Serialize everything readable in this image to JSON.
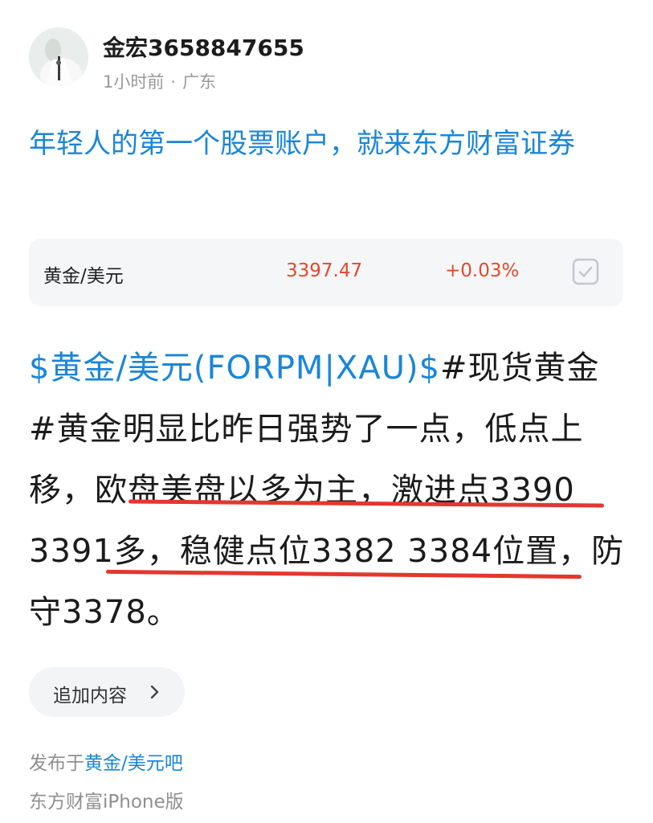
{
  "author": {
    "name": "金宏3658847655",
    "time": "1小时前",
    "separator": "·",
    "location": "广东"
  },
  "headline": {
    "text": "年轻人的第一个股票账户，就来东方财富证券"
  },
  "quote": {
    "name": "黄金/美元",
    "price": "3397.47",
    "change": "+0.03%",
    "price_color": "#e4482e",
    "icon": "checkbox-icon"
  },
  "post": {
    "tag": "$黄金/美元(FORPM|XAU)$",
    "body": "#现货黄金#黄金明显比昨日强势了一点，低点上移，欧盘美盘以多为主，激进点3390 3391多，稳健点位3382 3384位置，防守3378。",
    "tag_color": "#1a86d8",
    "highlight_color": "#e3372f"
  },
  "add_content": {
    "label": "追加内容",
    "icon": "chevron-right-icon"
  },
  "footer": {
    "published_prefix": "发布于",
    "forum": "黄金/美元吧",
    "source": "东方财富iPhone版"
  }
}
